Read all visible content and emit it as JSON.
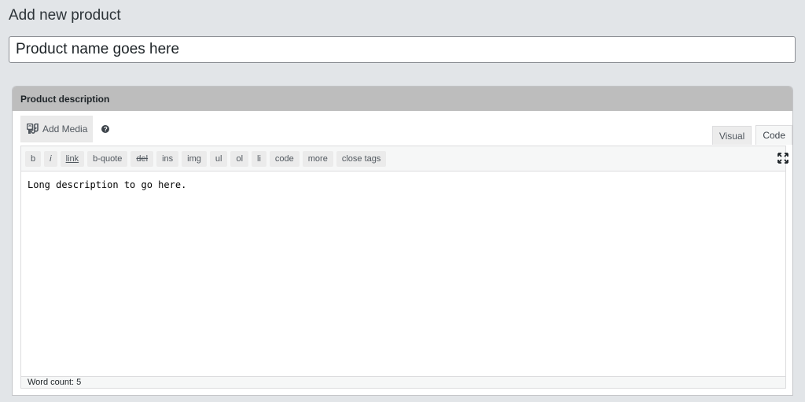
{
  "page": {
    "title": "Add new product"
  },
  "title_field": {
    "value": "Product name goes here"
  },
  "postbox": {
    "heading": "Product description"
  },
  "media": {
    "add_media_label": "Add Media",
    "icon": "media-icon",
    "help_glyph": "?"
  },
  "tabs": {
    "visual": "Visual",
    "code": "Code"
  },
  "quicktags": [
    "b",
    "i",
    "link",
    "b-quote",
    "del",
    "ins",
    "img",
    "ul",
    "ol",
    "li",
    "code",
    "more",
    "close tags"
  ],
  "editor": {
    "content": "Long description to go here."
  },
  "status": {
    "word_count": "Word count: 5"
  }
}
